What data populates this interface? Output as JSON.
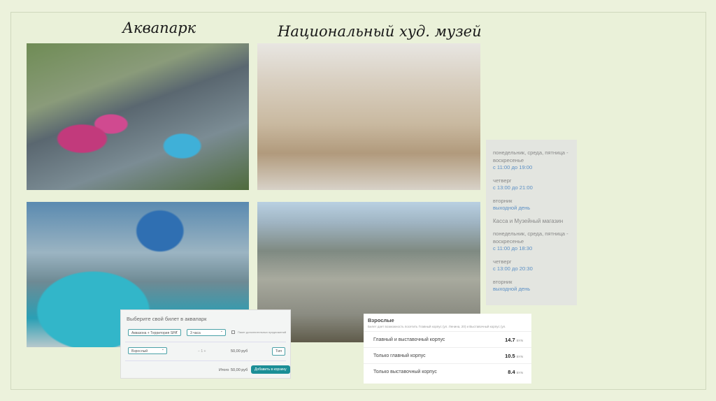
{
  "titles": {
    "aquapark": "Аквапарк",
    "museum": "Национальный худ. музей"
  },
  "schedule": {
    "museum": [
      {
        "days": "понедельник, среда, пятница - воскресенье",
        "time": "с 11:00 до 19:00"
      },
      {
        "days": "четверг",
        "time": "с 13:00 до 21:00"
      },
      {
        "days": "вторник",
        "time": "выходной день"
      }
    ],
    "shop_heading": "Касса и Музейный магазин",
    "shop": [
      {
        "days": "понедельник, среда, пятница - воскресенье",
        "time": "с 11:00 до 18:30"
      },
      {
        "days": "четверг",
        "time": "с 13:00 до 20:30"
      },
      {
        "days": "вторник",
        "time": "выходной день"
      }
    ]
  },
  "ticket": {
    "title": "Выберите свой билет в аквапарк",
    "zone": "Аквазона + Территория SPA",
    "duration": "3 часа",
    "checkbox_label": "Пакет дополнительных предложений",
    "category": "Взрослый",
    "qty": "1",
    "price": "50,00 руб",
    "type_button": "Тип",
    "total_label": "Итого",
    "total": "50,00 руб",
    "add_button": "Добавить в корзину"
  },
  "prices": {
    "heading": "Взрослые",
    "note": "Билет дает возможность посетить Главный корпус (ул. Ленина, 20) и Выставочный корпус (ул.",
    "currency": "BYN",
    "rows": [
      {
        "label": "Главный и выставочный корпус",
        "value": "14.7"
      },
      {
        "label": "Только главный корпус",
        "value": "10.5"
      },
      {
        "label": "Только выставочный корпус",
        "value": "8.4"
      }
    ]
  }
}
